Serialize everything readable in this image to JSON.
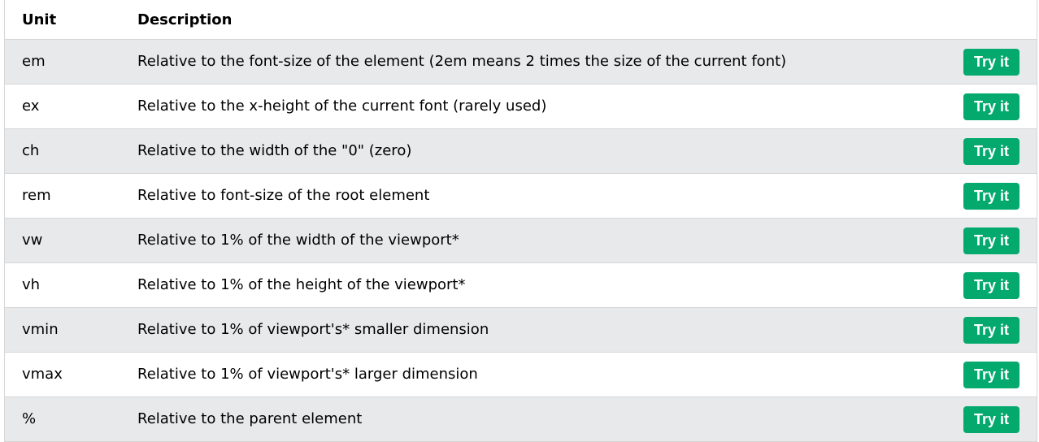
{
  "table": {
    "headers": {
      "unit": "Unit",
      "description": "Description"
    },
    "button_color": "#04aa6d",
    "row_alt_color": "#e7e9eb",
    "rows": [
      {
        "unit": "em",
        "description": "Relative to the font-size of the element (2em means 2 times the size of the current font)",
        "action": "Try it"
      },
      {
        "unit": "ex",
        "description": "Relative to the x-height of the current font (rarely used)",
        "action": "Try it"
      },
      {
        "unit": "ch",
        "description": "Relative to the width of the \"0\" (zero)",
        "action": "Try it"
      },
      {
        "unit": "rem",
        "description": "Relative to font-size of the root element",
        "action": "Try it"
      },
      {
        "unit": "vw",
        "description": "Relative to 1% of the width of the viewport*",
        "action": "Try it"
      },
      {
        "unit": "vh",
        "description": "Relative to 1% of the height of the viewport*",
        "action": "Try it"
      },
      {
        "unit": "vmin",
        "description": "Relative to 1% of viewport's* smaller dimension",
        "action": "Try it"
      },
      {
        "unit": "vmax",
        "description": "Relative to 1% of viewport's* larger dimension",
        "action": "Try it"
      },
      {
        "unit": "%",
        "description": "Relative to the parent element",
        "action": "Try it"
      }
    ]
  }
}
